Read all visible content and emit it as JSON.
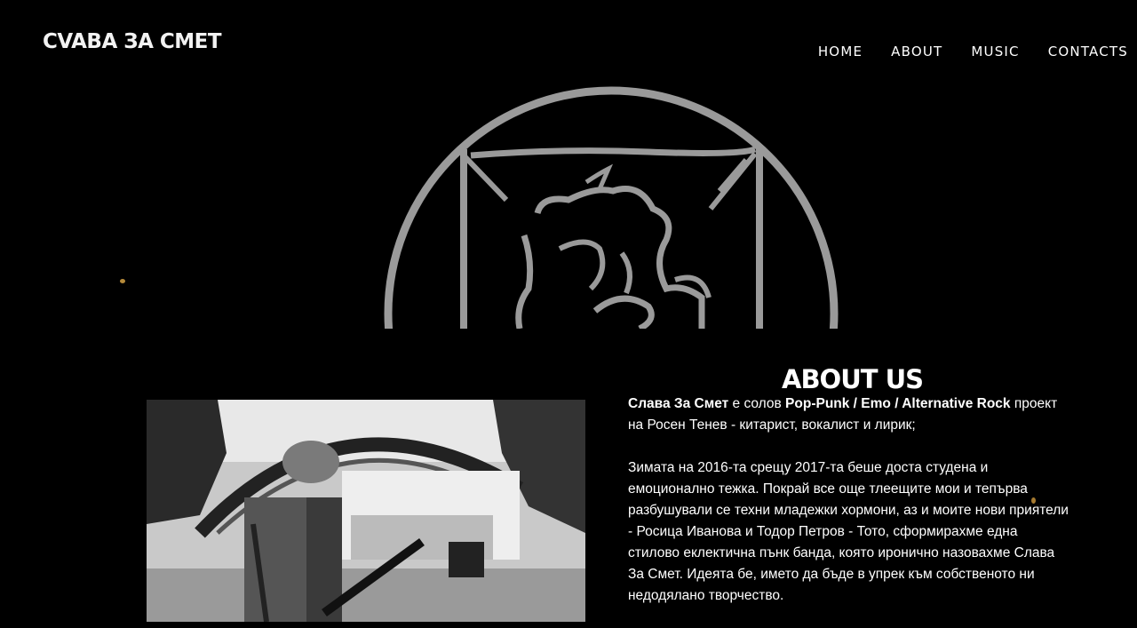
{
  "header": {
    "logo": "CVABA ЗA CMET",
    "nav": [
      "HOME",
      "ABOUT",
      "MUSIC",
      "CONTACTS"
    ]
  },
  "about": {
    "title": "ABOUT US",
    "p1_band": "Слава За Смет",
    "p1_mid": " е солов ",
    "p1_genre": "Pop-Punk / Emo / Alternative Rock",
    "p1_end": " проект на Росен Тенев - китарист, вокалист и лирик;",
    "p2": "Зимата на 2016-та срещу 2017-та беше доста студена и емоционално тежка. Покрай все още тлеещите мои и тепърва разбушували се техни младежки хормони, аз и моите нови приятели - Росица Иванова и Тодор Петров - Тото, сформирахме една стилово еклектична пънк банда, която иронично назовахме Слава За Смет. Идеята бе, името да бъде в упрек към собственото ни недодялано творчество."
  },
  "colors": {
    "background": "#000000",
    "hero_logo": "#9a9a9a"
  }
}
